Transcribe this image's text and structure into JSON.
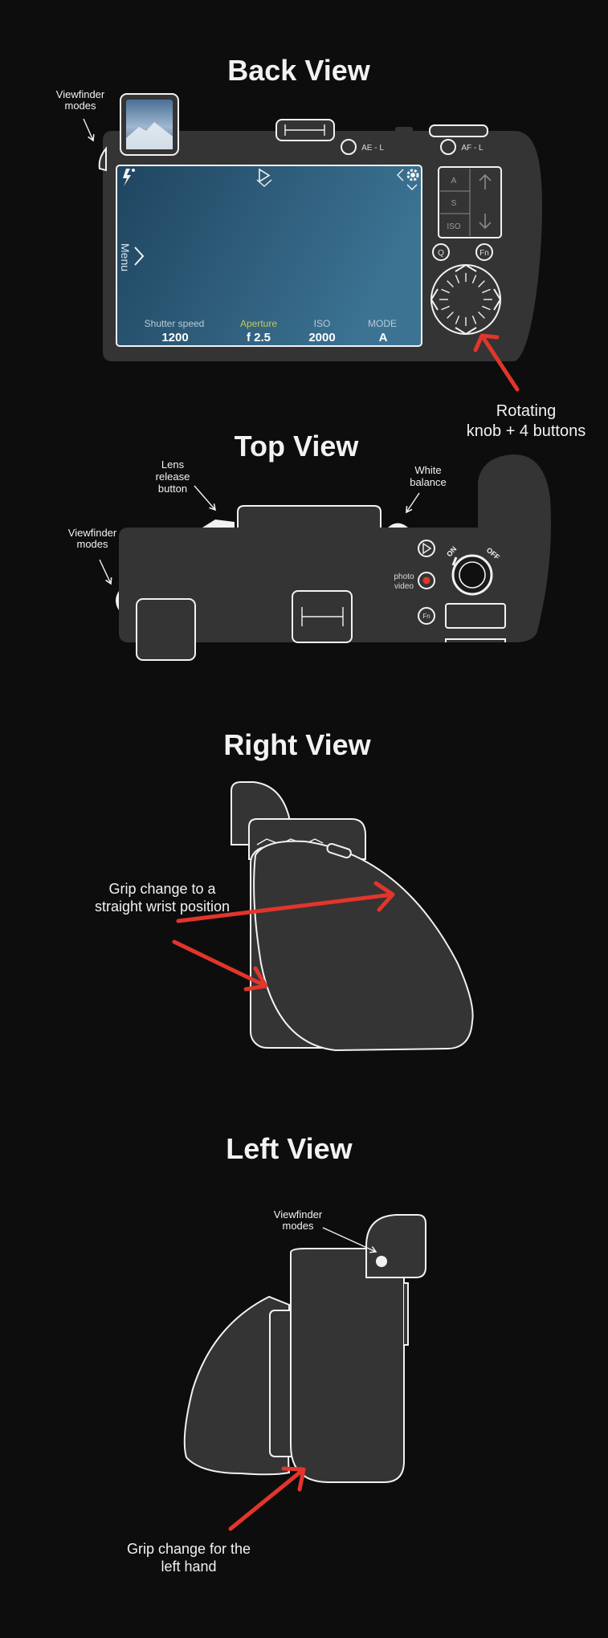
{
  "back_view": {
    "title": "Back View",
    "viewfinder_label": [
      "Viewfinder",
      "modes"
    ],
    "ae_label": "AE - L",
    "af_label": "AF - L",
    "screen": {
      "menu_label": "Menu",
      "fields": [
        {
          "label": "Shutter speed",
          "value": "1200"
        },
        {
          "label": "Aperture",
          "value": "f 2.5"
        },
        {
          "label": "ISO",
          "value": "2000"
        },
        {
          "label": "MODE",
          "value": "A"
        }
      ],
      "highlight_color": "#c8c65a"
    },
    "side_keys": [
      "A",
      "S",
      "ISO"
    ],
    "q_button": "Q",
    "fn_button": "Fn",
    "knob_label": [
      "Rotating",
      "knob + 4 buttons"
    ]
  },
  "top_view": {
    "title": "Top View",
    "lens_release_label": [
      "Lens",
      "release",
      "button"
    ],
    "white_balance_label": [
      "White",
      "balance"
    ],
    "viewfinder_label": [
      "Viewfinder",
      "modes"
    ],
    "photo_video_label": [
      "photo",
      "video"
    ],
    "on_label": "ON",
    "off_label": "OFF",
    "fn_button": "Fn"
  },
  "right_view": {
    "title": "Right View",
    "grip_label": [
      "Grip change to a",
      "straight wrist position"
    ]
  },
  "left_view": {
    "title": "Left View",
    "viewfinder_label": [
      "Viewfinder",
      "modes"
    ],
    "grip_label": [
      "Grip change for the",
      "left hand"
    ]
  },
  "colors": {
    "background": "#0d0d0d",
    "camera_body": "#343434",
    "outline": "#f2f2f2",
    "arrow_red": "#e2352b",
    "screen_blue": "#2f6383"
  },
  "icons": [
    "flash-icon",
    "play-icon",
    "settings-gear-icon",
    "chevron-icon",
    "arrow-up-icon",
    "arrow-down-icon",
    "record-icon",
    "pointer-arrow-icon"
  ]
}
